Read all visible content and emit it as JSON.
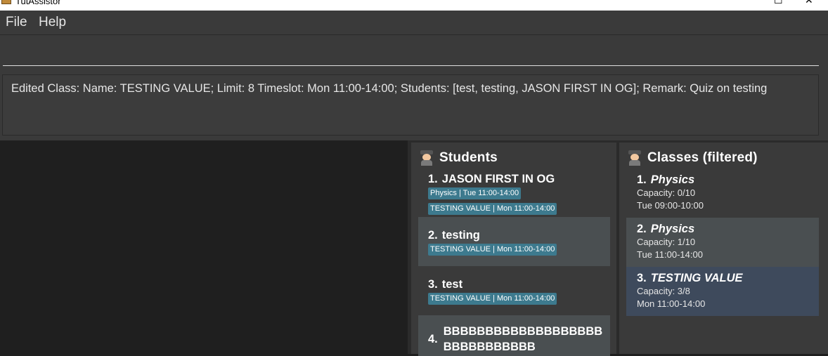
{
  "window": {
    "title": "TutAssistor"
  },
  "menu": {
    "file": "File",
    "help": "Help"
  },
  "command": {
    "value": "",
    "placeholder": ""
  },
  "result": {
    "text": "Edited Class: Name: TESTING VALUE; Limit: 8 Timeslot: Mon 11:00-14:00; Students: [test, testing, JASON FIRST IN OG]; Remark: Quiz on testing"
  },
  "students_panel": {
    "title": "Students",
    "items": [
      {
        "index": "1.",
        "name": "JASON FIRST IN OG",
        "tags": [
          "Physics | Tue 11:00-14:00",
          "TESTING VALUE | Mon 11:00-14:00"
        ]
      },
      {
        "index": "2.",
        "name": "testing",
        "tags": [
          "TESTING VALUE | Mon 11:00-14:00"
        ]
      },
      {
        "index": "3.",
        "name": "test",
        "tags": [
          "TESTING VALUE | Mon 11:00-14:00"
        ]
      },
      {
        "index": "4.",
        "name": "BBBBBBBBBBBBBBBBBBBBBBBBBBBBBB",
        "tags": []
      }
    ]
  },
  "classes_panel": {
    "title": "Classes (filtered)",
    "items": [
      {
        "index": "1.",
        "name": "Physics",
        "capacity": "Capacity: 0/10",
        "timeslot": "Tue 09:00-10:00"
      },
      {
        "index": "2.",
        "name": "Physics",
        "capacity": "Capacity: 1/10",
        "timeslot": "Tue 11:00-14:00"
      },
      {
        "index": "3.",
        "name": "TESTING VALUE",
        "capacity": "Capacity: 3/8",
        "timeslot": "Mon 11:00-14:00"
      }
    ]
  },
  "colors": {
    "tag": "#3d7a8e",
    "selected_card": "#3e4a5c",
    "alt_card": "#4a4f51",
    "panel_bg": "#3a3a3a"
  }
}
